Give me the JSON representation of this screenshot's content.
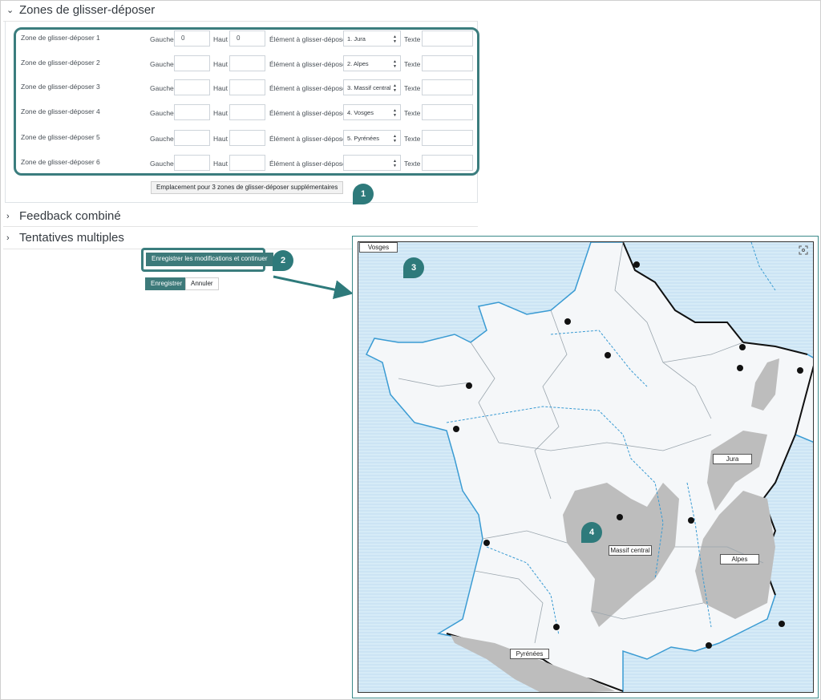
{
  "sections": {
    "zones_title": "Zones de glisser-déposer",
    "feedback_title": "Feedback combiné",
    "attempts_title": "Tentatives multiples"
  },
  "labels": {
    "left": "Gauche",
    "top": "Haut",
    "element": "Élément à glisser-déposer",
    "text": "Texte"
  },
  "zones": [
    {
      "label": "Zone de glisser-déposer 1",
      "left": "0",
      "top": "0",
      "element": "1. Jura"
    },
    {
      "label": "Zone de glisser-déposer 2",
      "left": "",
      "top": "",
      "element": "2. Alpes"
    },
    {
      "label": "Zone de glisser-déposer 3",
      "left": "",
      "top": "",
      "element": "3. Massif central"
    },
    {
      "label": "Zone de glisser-déposer 4",
      "left": "",
      "top": "",
      "element": "4. Vosges"
    },
    {
      "label": "Zone de glisser-déposer 5",
      "left": "",
      "top": "",
      "element": "5. Pyrénées"
    },
    {
      "label": "Zone de glisser-déposer 6",
      "left": "",
      "top": "",
      "element": ""
    }
  ],
  "buttons": {
    "add_zones": "Emplacement pour 3 zones de glisser-déposer supplémentaires",
    "save_continue": "Enregistrer les modifications et continuer",
    "save": "Enregistrer",
    "cancel": "Annuler"
  },
  "callouts": [
    "1",
    "2",
    "3",
    "4"
  ],
  "map_labels": {
    "vosges": "Vosges",
    "jura": "Jura",
    "massif": "Massif central",
    "alpes": "Alpes",
    "pyrenees": "Pyrénées"
  },
  "colors": {
    "accent": "#3b7d7e",
    "primary_button": "#3d7a7a",
    "sea": "#d4eaf7",
    "mountains": "#bdbdbd"
  }
}
